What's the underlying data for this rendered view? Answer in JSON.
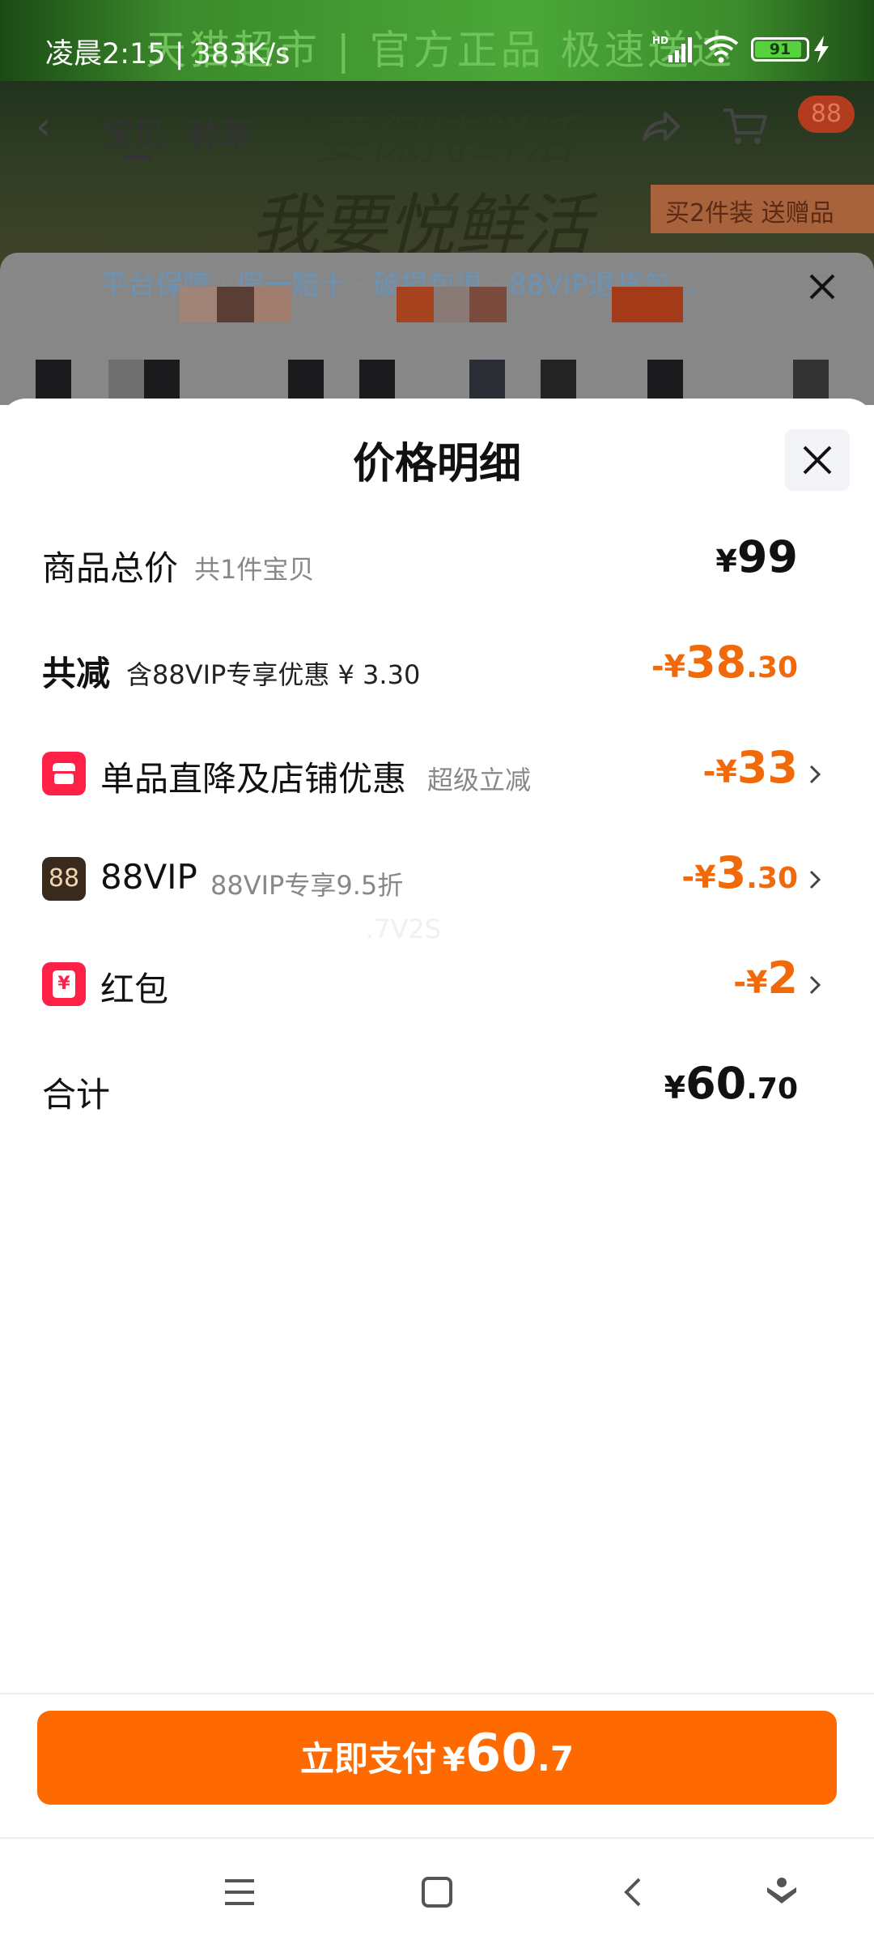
{
  "status_bar": {
    "time_speed": "凌晨2:15 | 383K/s",
    "signal_label": "HD",
    "battery_level": "91"
  },
  "background_page": {
    "banner_text": "天猫超市 | 官方正品 极速送达",
    "hero_slogan_1": "要保持鲜活",
    "hero_slogan_2": "我要悦鲜活",
    "promo_tag": "买2件装 送赠品",
    "tabs": [
      "宝贝",
      "种草"
    ],
    "cart_badge": "88",
    "guarantee_text": "平台保障 · 假一赔十 · 破损包退 · 88VIP退货包..."
  },
  "sheet": {
    "title": "价格明细",
    "rows": [
      {
        "label": "商品总价",
        "sub": "共1件宝贝",
        "prefix": "",
        "currency": "¥",
        "int": "99",
        "dec": ""
      },
      {
        "label": "共减",
        "sub": "含88VIP专享优惠 ¥ 3.30",
        "prefix": "-",
        "currency": "¥",
        "int": "38",
        "dec": ".30"
      },
      {
        "label": "单品直降及店铺优惠",
        "sub": "超级立减",
        "prefix": "-",
        "currency": "¥",
        "int": "33",
        "dec": "",
        "icon": "store-icon"
      },
      {
        "label": "88VIP",
        "sub": "88VIP专享9.5折",
        "prefix": "-",
        "currency": "¥",
        "int": "3",
        "dec": ".30",
        "icon": "88vip-icon",
        "icon_text": "88"
      },
      {
        "label": "红包",
        "sub": "",
        "prefix": "-",
        "currency": "¥",
        "int": "2",
        "dec": "",
        "icon": "red-packet-icon",
        "icon_text": "¥"
      },
      {
        "label": "合计",
        "sub": "",
        "prefix": "",
        "currency": "¥",
        "int": "60",
        "dec": ".70"
      }
    ],
    "watermark": ".7V2S"
  },
  "pay_button": {
    "label": "立即支付",
    "currency": "¥",
    "int": "60",
    "dec": ".7"
  },
  "colors": {
    "accent": "#fe6a00",
    "discount": "#f06a0c",
    "brand_red": "#ff2048",
    "vip_brown": "#3a2a1e"
  }
}
